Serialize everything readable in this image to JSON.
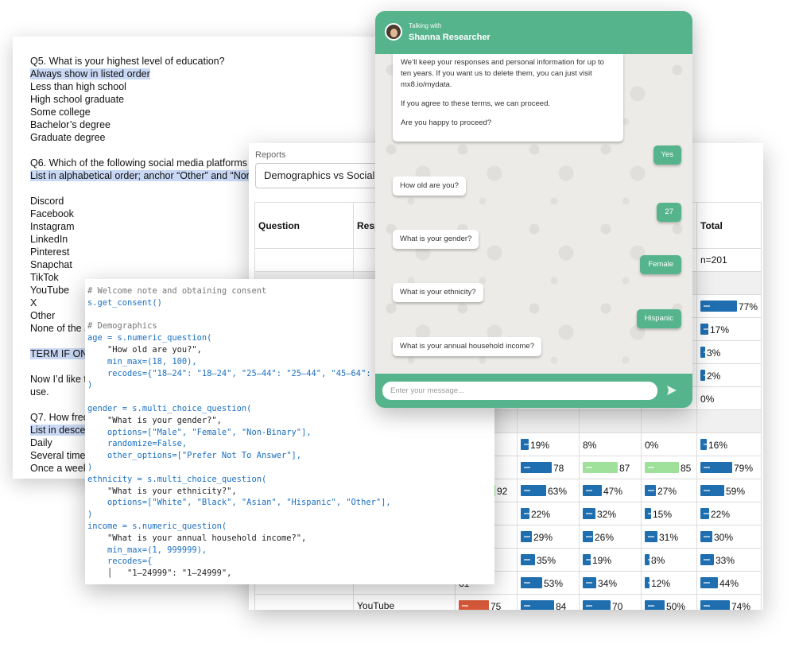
{
  "document": {
    "lines": [
      {
        "text": "Q5. What is your highest level of education?",
        "hl": false
      },
      {
        "text": "Always show in listed order",
        "hl": true
      },
      {
        "text": "Less than high school",
        "hl": false
      },
      {
        "text": "High school graduate",
        "hl": false
      },
      {
        "text": "Some college",
        "hl": false
      },
      {
        "text": "Bachelor’s degree",
        "hl": false
      },
      {
        "text": "Graduate degree",
        "hl": false
      },
      {
        "text": "",
        "hl": false
      },
      {
        "text": "Q6. Which of the following social media platforms ar",
        "hl": false
      },
      {
        "text": "List in alphabetical order; anchor “Other” and “None",
        "hl": true
      },
      {
        "text": "",
        "hl": false
      },
      {
        "text": "Discord",
        "hl": false
      },
      {
        "text": "Facebook",
        "hl": false
      },
      {
        "text": "Instagram",
        "hl": false
      },
      {
        "text": "LinkedIn",
        "hl": false
      },
      {
        "text": "Pinterest",
        "hl": false
      },
      {
        "text": "Snapchat",
        "hl": false
      },
      {
        "text": "TikTok",
        "hl": false
      },
      {
        "text": "YouTube",
        "hl": false
      },
      {
        "text": "X",
        "hl": false
      },
      {
        "text": "Other",
        "hl": false
      },
      {
        "text": "None of the a",
        "hl": false
      },
      {
        "text": "",
        "hl": false
      },
      {
        "text": "TERM IF ON",
        "hl": true
      },
      {
        "text": "",
        "hl": false
      },
      {
        "text": "Now I’d like t",
        "hl": false
      },
      {
        "text": "use.",
        "hl": false
      },
      {
        "text": "",
        "hl": false
      },
      {
        "text": "Q7. How freq",
        "hl": false
      },
      {
        "text": "List in descen",
        "hl": true
      },
      {
        "text": "Daily",
        "hl": false
      },
      {
        "text": "Several times",
        "hl": false
      },
      {
        "text": "Once a week",
        "hl": false
      }
    ]
  },
  "report": {
    "label": "Reports",
    "selected": "Demographics vs Social",
    "col_question": "Question",
    "col_response": "Respo",
    "col_total": "Total",
    "n_total": "n=201",
    "rows": [
      {
        "cells": [
          {
            "v": 77,
            "t": "77%",
            "c": "blue"
          }
        ],
        "group": "total_only"
      },
      {
        "cells": [
          {
            "v": 17,
            "t": "17%",
            "c": "blue"
          }
        ],
        "group": "total_only"
      },
      {
        "cells": [
          {
            "v": 3,
            "t": "3%",
            "c": "blue"
          }
        ],
        "group": "total_only"
      },
      {
        "cells": [
          {
            "v": 2,
            "t": "2%",
            "c": "blue"
          }
        ],
        "group": "total_only"
      },
      {
        "cells": [
          {
            "v": 0,
            "t": "0%",
            "c": "blue"
          }
        ],
        "group": "total_only"
      }
    ],
    "lower_rows": [
      {
        "label": "",
        "cells": [
          {
            "t": "%",
            "v": 0,
            "c": "none"
          },
          {
            "t": "19%",
            "v": 19,
            "c": "blue"
          },
          {
            "t": "8%",
            "v": 8,
            "c": "none"
          },
          {
            "t": "0%",
            "v": 0,
            "c": "none"
          },
          {
            "t": "16%",
            "v": 16,
            "c": "blue"
          }
        ]
      },
      {
        "label": "",
        "cells": [
          {
            "t": "67",
            "v": 67,
            "c": "none"
          },
          {
            "t": "78",
            "v": 78,
            "c": "blue"
          },
          {
            "t": "87",
            "v": 87,
            "c": "green"
          },
          {
            "t": "85",
            "v": 85,
            "c": "green"
          },
          {
            "t": "79%",
            "v": 79,
            "c": "blue"
          }
        ]
      },
      {
        "label": "",
        "cells": [
          {
            "t": "92",
            "v": 92,
            "c": "green"
          },
          {
            "t": "63%",
            "v": 63,
            "c": "blue"
          },
          {
            "t": "47%",
            "v": 47,
            "c": "blue"
          },
          {
            "t": "27%",
            "v": 27,
            "c": "blue"
          },
          {
            "t": "59%",
            "v": 59,
            "c": "blue"
          }
        ]
      },
      {
        "label": "",
        "cells": [
          {
            "t": "",
            "v": 0,
            "c": "none"
          },
          {
            "t": "22%",
            "v": 22,
            "c": "blue"
          },
          {
            "t": "32%",
            "v": 32,
            "c": "blue"
          },
          {
            "t": "15%",
            "v": 15,
            "c": "blue"
          },
          {
            "t": "22%",
            "v": 22,
            "c": "blue"
          }
        ]
      },
      {
        "label": "",
        "cells": [
          {
            "t": "%",
            "v": 0,
            "c": "none"
          },
          {
            "t": "29%",
            "v": 29,
            "c": "blue"
          },
          {
            "t": "26%",
            "v": 26,
            "c": "blue"
          },
          {
            "t": "31%",
            "v": 31,
            "c": "blue"
          },
          {
            "t": "30%",
            "v": 30,
            "c": "blue"
          }
        ]
      },
      {
        "label": "",
        "cells": [
          {
            "t": "67",
            "v": 67,
            "c": "none"
          },
          {
            "t": "35%",
            "v": 35,
            "c": "blue"
          },
          {
            "t": "19%",
            "v": 19,
            "c": "blue"
          },
          {
            "t": "8%",
            "v": 8,
            "c": "blue"
          },
          {
            "t": "33%",
            "v": 33,
            "c": "blue"
          }
        ]
      },
      {
        "label": "",
        "cells": [
          {
            "t": "61",
            "v": 61,
            "c": "none"
          },
          {
            "t": "53%",
            "v": 53,
            "c": "blue"
          },
          {
            "t": "34%",
            "v": 34,
            "c": "blue"
          },
          {
            "t": "12%",
            "v": 12,
            "c": "blue"
          },
          {
            "t": "44%",
            "v": 44,
            "c": "blue"
          }
        ]
      },
      {
        "label": "YouTube",
        "cells": [
          {
            "t": "75",
            "v": 75,
            "c": "red"
          },
          {
            "t": "84",
            "v": 84,
            "c": "blue"
          },
          {
            "t": "70",
            "v": 70,
            "c": "blue"
          },
          {
            "t": "50%",
            "v": 50,
            "c": "blue"
          },
          {
            "t": "74%",
            "v": 74,
            "c": "blue"
          }
        ]
      }
    ]
  },
  "code": {
    "lines": [
      [
        {
          "t": "# Welcome note and obtaining consent",
          "c": "com"
        }
      ],
      [
        {
          "t": "s.get_consent()",
          "c": "kw"
        }
      ],
      [
        {
          "t": "",
          "c": "str"
        }
      ],
      [
        {
          "t": "# Demographics",
          "c": "com"
        }
      ],
      [
        {
          "t": "age = s.numeric_question(",
          "c": "kw"
        }
      ],
      [
        {
          "t": "    \"How old are you?\",",
          "c": "str"
        }
      ],
      [
        {
          "t": "    min_max=(18, 100),",
          "c": "kw"
        }
      ],
      [
        {
          "t": "    recodes={\"18–24\": \"18–24\", \"25–44\": \"25–44\", \"45–64\": \"45",
          "c": "kw"
        }
      ],
      [
        {
          "t": ")",
          "c": "kw"
        }
      ],
      [
        {
          "t": "",
          "c": "str"
        }
      ],
      [
        {
          "t": "gender = s.multi_choice_question(",
          "c": "kw"
        }
      ],
      [
        {
          "t": "    \"What is your gender?\",",
          "c": "str"
        }
      ],
      [
        {
          "t": "    options=[\"Male\", \"Female\", \"Non-Binary\"],",
          "c": "kw"
        }
      ],
      [
        {
          "t": "    randomize=False,",
          "c": "kw"
        }
      ],
      [
        {
          "t": "    other_options=[\"Prefer Not To Answer\"],",
          "c": "kw"
        }
      ],
      [
        {
          "t": ")",
          "c": "kw"
        }
      ],
      [
        {
          "t": "ethnicity = s.multi_choice_question(",
          "c": "kw"
        }
      ],
      [
        {
          "t": "    \"What is your ethnicity?\",",
          "c": "str"
        }
      ],
      [
        {
          "t": "    options=[\"White\", \"Black\", \"Asian\", \"Hispanic\", \"Other\"],",
          "c": "kw"
        }
      ],
      [
        {
          "t": ")",
          "c": "kw"
        }
      ],
      [
        {
          "t": "income = s.numeric_question(",
          "c": "kw"
        }
      ],
      [
        {
          "t": "    \"What is your annual household income?\",",
          "c": "str"
        }
      ],
      [
        {
          "t": "    min_max=(1, 999999),",
          "c": "kw"
        }
      ],
      [
        {
          "t": "    recodes={",
          "c": "kw"
        }
      ],
      [
        {
          "t": "    │   \"1–24999\": \"1–24999\",",
          "c": "str"
        }
      ]
    ]
  },
  "chat": {
    "talking_with": "Talking with",
    "agent_name": "Shanna Researcher",
    "intro": [
      "We’ll keep your responses and personal information for up to ten years. If you want us to delete them, you can just visit mx8.io/mydata.",
      "If you agree to these terms, we can proceed.",
      "Are you happy to proceed?"
    ],
    "messages": [
      {
        "from": "me",
        "text": "Yes"
      },
      {
        "from": "bot",
        "text": "How old are you?"
      },
      {
        "from": "me",
        "text": "27"
      },
      {
        "from": "bot",
        "text": "What is your gender?"
      },
      {
        "from": "me",
        "text": "Female"
      },
      {
        "from": "bot",
        "text": "What is your ethnicity?"
      },
      {
        "from": "me",
        "text": "Hispanic"
      },
      {
        "from": "bot",
        "text": "What is your annual household income?"
      }
    ],
    "input_placeholder": "Enter your message...",
    "colors": {
      "header": "#55b48c",
      "bubble_me": "#55b48c"
    },
    "send_icon": "send-icon"
  }
}
